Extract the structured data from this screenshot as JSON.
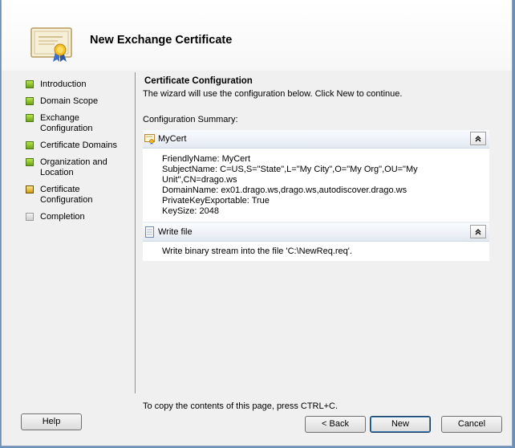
{
  "window": {
    "title": "New Exchange Certificate"
  },
  "nav": {
    "items": [
      {
        "label": "Introduction",
        "state": "done"
      },
      {
        "label": "Domain Scope",
        "state": "done"
      },
      {
        "label": "Exchange Configuration",
        "state": "done"
      },
      {
        "label": "Certificate Domains",
        "state": "done"
      },
      {
        "label": "Organization and Location",
        "state": "done"
      },
      {
        "label": "Certificate Configuration",
        "state": "current"
      },
      {
        "label": "Completion",
        "state": "pending"
      }
    ]
  },
  "main": {
    "section_title": "Certificate Configuration",
    "description": "The wizard will use the configuration below.  Click New to continue.",
    "summary_label": "Configuration Summary:",
    "panels": [
      {
        "title": "MyCert",
        "icon": "certificate-icon",
        "lines": [
          "FriendlyName: MyCert",
          "SubjectName: C=US,S=\"State\",L=\"My City\",O=\"My Org\",OU=\"My",
          "Unit\",CN=drago.ws",
          "DomainName: ex01.drago.ws,drago.ws,autodiscover.drago.ws",
          "PrivateKeyExportable: True",
          "KeySize: 2048"
        ]
      },
      {
        "title": "Write file",
        "icon": "file-icon",
        "lines": [
          "Write binary stream into the file 'C:\\NewReq.req'."
        ]
      }
    ],
    "collapse_glyph": "≈"
  },
  "footer": {
    "note": "To copy the contents of this page, press CTRL+C.",
    "help": "Help",
    "back": "< Back",
    "next": "New",
    "cancel": "Cancel"
  },
  "colors": {
    "header_bg": "#ffffff",
    "window_bg": "#f0f0f0",
    "done_icon": "#7cb82f",
    "current_icon": "#e6b422",
    "panel_header": "#e3e9f1"
  }
}
